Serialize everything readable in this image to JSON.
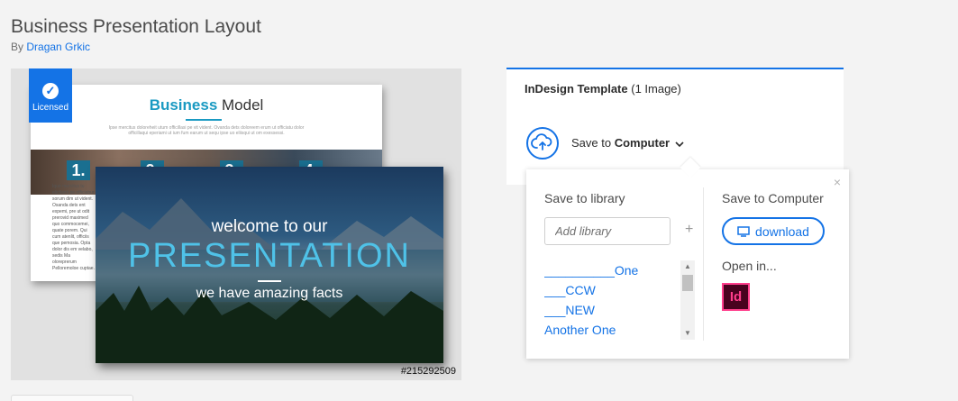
{
  "page": {
    "title": "Business Presentation Layout",
    "by_prefix": "By",
    "author": "Dragan Grkic"
  },
  "preview": {
    "badge_label": "Licensed",
    "back_slide": {
      "title_bold": "Business",
      "title_rest": " Model",
      "subtitle": "Ipse mercitus doloreheit utum officillasi pe vit vident. Ovanda dets doloreem erum ut officiatu dolor officillaqui eperiami ut ium fum earum ut sequ ipse uo eliisqui ut om exessessi.",
      "numbers": [
        "1.",
        "2.",
        "3.",
        "4."
      ],
      "text_col": "Ique mercitus tu elicfianti pe officiabur sorum dim ut vident. Osanda dets ent expemi, pre ut odit prerovid maximed quo commocemei, quate porem. Qui cum atenlit, officiis que pemosia. Opta dolor dis em velabo, sedis Ma oloreprerum Pelloremoloe cuptae."
    },
    "front_slide": {
      "welcome": "welcome to our",
      "headline": "PRESENTATION",
      "facts": "we have amazing facts"
    },
    "asset_id": "#215292509"
  },
  "panel": {
    "title_bold": "InDesign Template",
    "title_rest": " (1 Image)",
    "save_to_label": "Save to",
    "save_to_target": "Computer",
    "icon": "cloud-upload-icon"
  },
  "popover": {
    "close_label": "×",
    "left_heading": "Save to library",
    "library_placeholder": "Add library",
    "plus_label": "+",
    "libraries": [
      "__________One",
      "___CCW",
      "___NEW",
      "Another One"
    ],
    "right_heading": "Save to Computer",
    "download_label": "download",
    "open_in_label": "Open in...",
    "app_icon_label": "Id"
  },
  "colors": {
    "accent": "#1473e6",
    "indesign_pink": "#ff3d8b",
    "indesign_bg": "#49021f",
    "slide_cyan": "#4fc2e8"
  }
}
